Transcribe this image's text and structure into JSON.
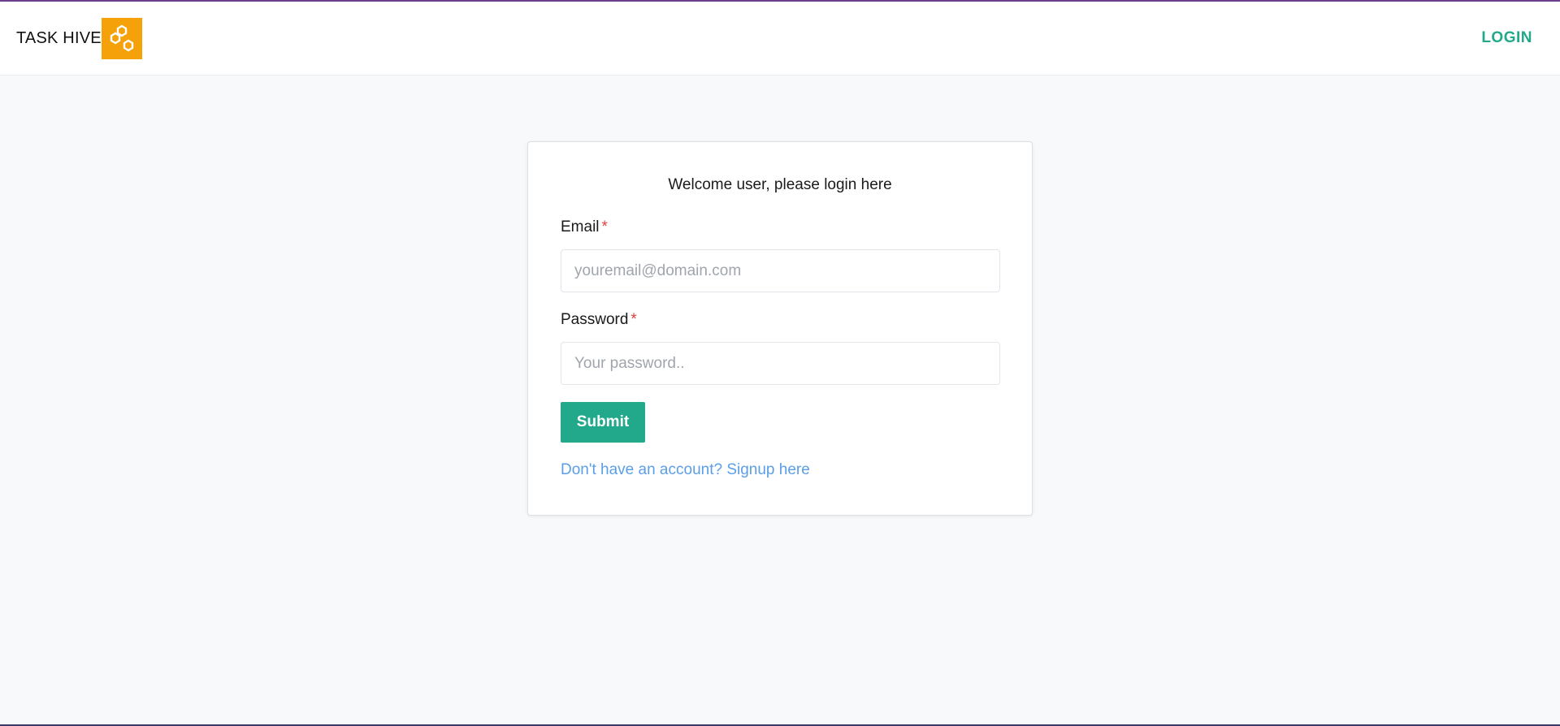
{
  "header": {
    "brand_text": "TASK HIVE",
    "logo_icon": "honeycomb-icon",
    "nav_login_label": "LOGIN"
  },
  "login_card": {
    "title": "Welcome user, please login here",
    "email": {
      "label": "Email",
      "required_mark": "*",
      "value": "",
      "placeholder": "youremail@domain.com"
    },
    "password": {
      "label": "Password",
      "required_mark": "*",
      "value": "",
      "placeholder": "Your password.."
    },
    "submit_label": "Submit",
    "signup_link": "Don't have an account? Signup here"
  },
  "colors": {
    "accent": "#22a98b",
    "logo_bg": "#f5a10a",
    "link": "#5b9ee8",
    "required": "#e53e3e",
    "page_bg": "#f8f9fb"
  }
}
